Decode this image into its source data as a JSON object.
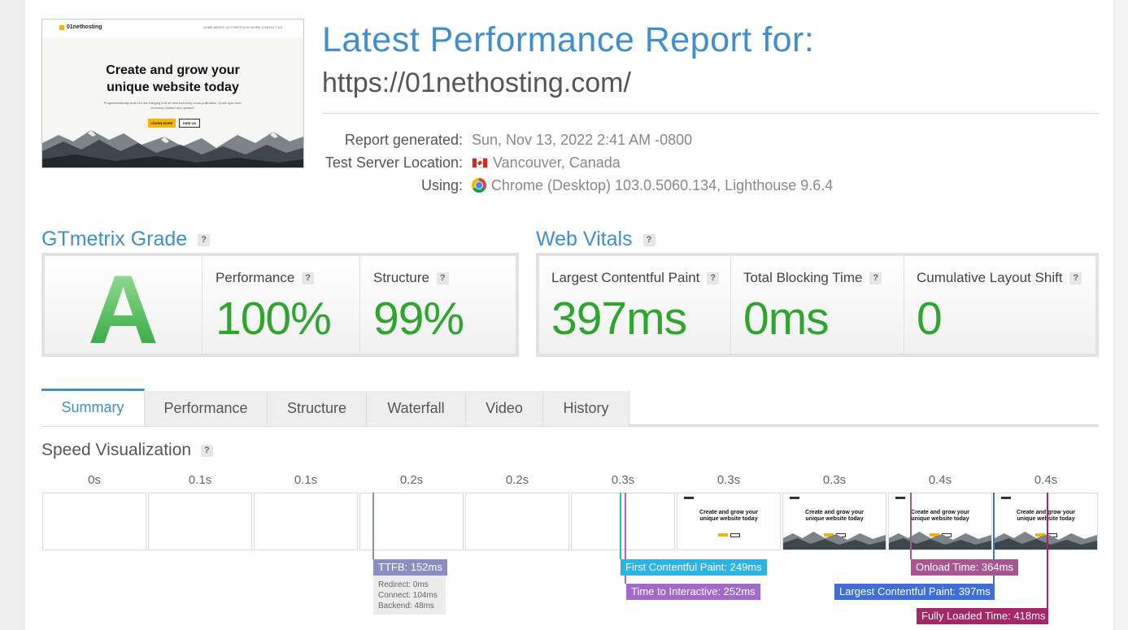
{
  "header": {
    "title": "Latest Performance Report for:",
    "url": "https://01nethosting.com/"
  },
  "thumbnail": {
    "logo": "01nethosting",
    "nav": "HOME   ABOUT US   PORTFOLIO   WORK   CONTACT US",
    "headline_line1": "Create and grow your",
    "headline_line2": "unique website today",
    "paragraph": "Programmatically work but low hanging fruit so new economy cross-pollination. Quick sync new economy onward and upward.",
    "btn_primary": "LEARN MORE",
    "btn_secondary": "HIRE US"
  },
  "meta": {
    "generated_label": "Report generated:",
    "generated_value": "Sun, Nov 13, 2022 2:41 AM -0800",
    "location_label": "Test Server Location:",
    "location_value": "Vancouver, Canada",
    "using_label": "Using:",
    "using_value": "Chrome (Desktop) 103.0.5060.134, Lighthouse 9.6.4"
  },
  "grade": {
    "title": "GTmetrix Grade",
    "help": "?",
    "letter": "A",
    "performance_label": "Performance",
    "performance_value": "100%",
    "structure_label": "Structure",
    "structure_value": "99%"
  },
  "vitals": {
    "title": "Web Vitals",
    "help": "?",
    "lcp_label": "Largest Contentful Paint",
    "lcp_value": "397ms",
    "tbt_label": "Total Blocking Time",
    "tbt_value": "0ms",
    "cls_label": "Cumulative Layout Shift",
    "cls_value": "0"
  },
  "tabs": [
    "Summary",
    "Performance",
    "Structure",
    "Waterfall",
    "Video",
    "History"
  ],
  "active_tab": "Summary",
  "speed": {
    "title": "Speed Visualization",
    "help": "?",
    "ticks": [
      "0s",
      "0.1s",
      "0.1s",
      "0.2s",
      "0.2s",
      "0.3s",
      "0.3s",
      "0.3s",
      "0.4s",
      "0.4s"
    ],
    "frame_headline_line1": "Create and grow your",
    "frame_headline_line2": "unique website today",
    "markers": {
      "ttfb": "TTFB: 152ms",
      "redirect": "Redirect: 0ms",
      "connect": "Connect: 104ms",
      "backend": "Backend: 48ms",
      "fcp": "First Contentful Paint: 249ms",
      "tti": "Time to Interactive: 252ms",
      "onload": "Onload Time: 364ms",
      "lcp": "Largest Contentful Paint: 397ms",
      "fully_loaded": "Fully Loaded Time: 418ms"
    }
  },
  "colors": {
    "brand_blue": "#3f8fcf",
    "grade_green": "#2ea52e",
    "ttfb": "#8b8fbf",
    "fcp": "#2ab4e3",
    "tti": "#a169c9",
    "onload": "#a8568f",
    "lcp": "#3d6fd6",
    "fully_loaded": "#a52767"
  }
}
